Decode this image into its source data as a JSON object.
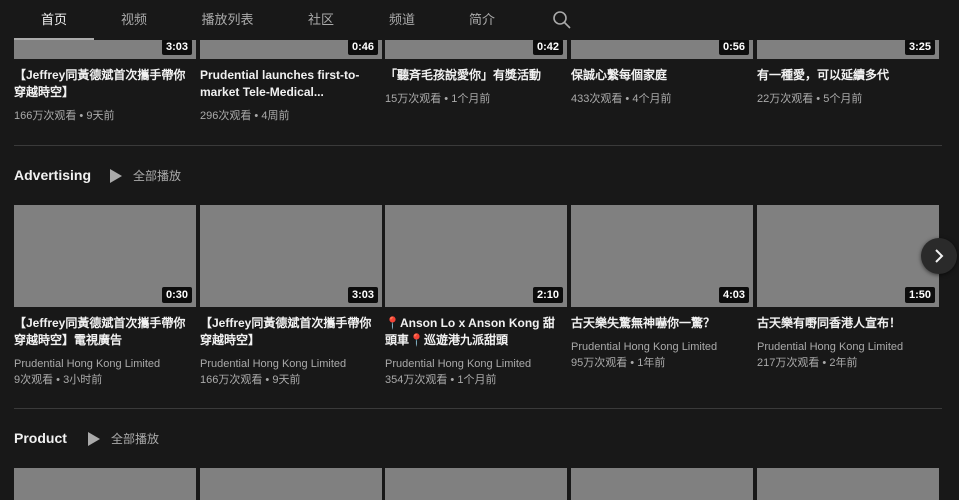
{
  "tabs": [
    "首页",
    "视频",
    "播放列表",
    "社区",
    "频道",
    "简介"
  ],
  "top_row": [
    {
      "duration": "3:03",
      "title": "【Jeffrey同黃德斌首次攜手帶你穿越時空】",
      "views": "166万次观看",
      "age": "9天前"
    },
    {
      "duration": "0:46",
      "title": "Prudential launches first-to-market Tele-Medical...",
      "views": "296次观看",
      "age": "4周前"
    },
    {
      "duration": "0:42",
      "title": "「聽斉毛孩說愛你」有獎活動",
      "views": "15万次观看",
      "age": "1个月前"
    },
    {
      "duration": "0:56",
      "title": "保誠心繫每個家庭",
      "views": "433次观看",
      "age": "4个月前"
    },
    {
      "duration": "3:25",
      "title": "有一種愛，可以延續多代",
      "views": "22万次观看",
      "age": "5个月前"
    }
  ],
  "shelves": [
    {
      "title": "Advertising",
      "play_all": "全部播放",
      "videos": [
        {
          "duration": "0:30",
          "title": "【Jeffrey同黃德斌首次攜手帶你穿越時空】電視廣告",
          "channel": "Prudential Hong Kong Limited",
          "views": "9次观看",
          "age": "3小时前"
        },
        {
          "duration": "3:03",
          "title": "【Jeffrey同黃德斌首次攜手帶你穿越時空】",
          "channel": "Prudential Hong Kong Limited",
          "views": "166万次观看",
          "age": "9天前"
        },
        {
          "duration": "2:10",
          "title": "📍Anson Lo x Anson Kong 甜頭車📍巡遊港九派甜頭",
          "channel": "Prudential Hong Kong Limited",
          "views": "354万次观看",
          "age": "1个月前"
        },
        {
          "duration": "4:03",
          "title": "古天樂失驚無神嚇你一驚？",
          "channel": "Prudential Hong Kong Limited",
          "views": "95万次观看",
          "age": "1年前"
        },
        {
          "duration": "1:50",
          "title": "古天樂有嘢同香港人宣布！",
          "channel": "Prudential Hong Kong Limited",
          "views": "217万次观看",
          "age": "2年前"
        }
      ]
    },
    {
      "title": "Product",
      "play_all": "全部播放"
    }
  ]
}
